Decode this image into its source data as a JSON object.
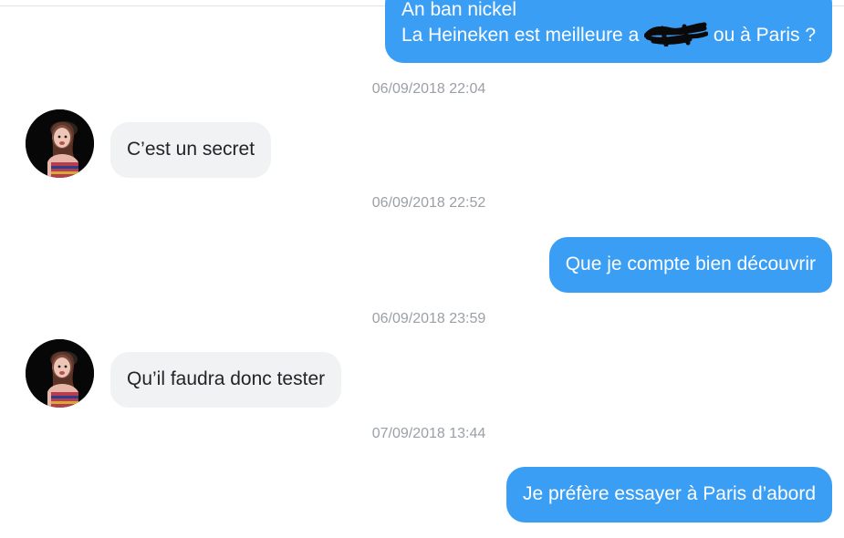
{
  "messages": {
    "first_out": {
      "line1": "An ban nickel",
      "line2_before": "La Heineken est meilleure a ",
      "line2_after": " ou à Paris ?"
    },
    "t1": "06/09/2018 22:04",
    "m1": "C’est un secret",
    "t2": "06/09/2018 22:52",
    "m2": "Que je compte bien découvrir",
    "t3": "06/09/2018 23:59",
    "m3": "Qu’il faudra donc tester",
    "t4": "07/09/2018 13:44",
    "m4": "Je préfère essayer à Paris d’abord"
  },
  "colors": {
    "outgoing_bubble": "#3b9ef5",
    "incoming_bubble": "#f1f2f3",
    "timestamp": "#9aa0a6"
  }
}
